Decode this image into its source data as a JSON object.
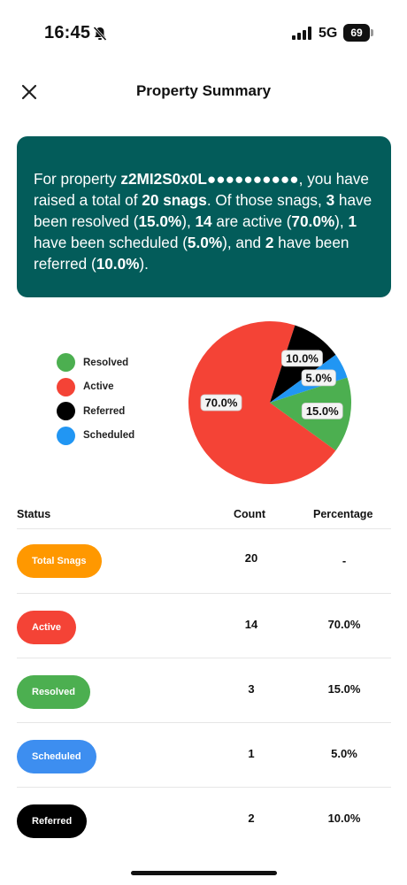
{
  "status_bar": {
    "time": "16:45",
    "network": "5G",
    "battery": "69",
    "bell_icon": "bell-muted-icon",
    "signal_icon": "signal-bars-icon"
  },
  "header": {
    "title": "Property Summary",
    "close_icon": "close-icon"
  },
  "summary": {
    "t1": "For property ",
    "property_id": "z2MI2S0x0L●●●●●●●●●●",
    "t2": ", you have raised a total of ",
    "total": "20 snags",
    "t3": ". Of those snags, ",
    "resolved_count": "3",
    "t4": " have been resolved (",
    "resolved_pct": "15.0%",
    "t5": "), ",
    "active_count": "14",
    "t6": " are active (",
    "active_pct": "70.0%",
    "t7": "), ",
    "scheduled_count": "1",
    "t8": " have been scheduled (",
    "scheduled_pct": "5.0%",
    "t9": "), and ",
    "referred_count": "2",
    "t10": " have been referred (",
    "referred_pct": "10.0%",
    "t11": ")."
  },
  "legend": [
    {
      "label": "Resolved",
      "color": "#4caf50"
    },
    {
      "label": "Active",
      "color": "#f44336"
    },
    {
      "label": "Referred",
      "color": "#000000"
    },
    {
      "label": "Scheduled",
      "color": "#2196f3"
    }
  ],
  "chart_data": {
    "type": "pie",
    "slices": [
      {
        "name": "Resolved",
        "value": 15.0,
        "label": "15.0%",
        "color": "#4caf50"
      },
      {
        "name": "Active",
        "value": 70.0,
        "label": "70.0%",
        "color": "#f44336"
      },
      {
        "name": "Referred",
        "value": 10.0,
        "label": "10.0%",
        "color": "#000000"
      },
      {
        "name": "Scheduled",
        "value": 5.0,
        "label": "5.0%",
        "color": "#2196f3"
      }
    ]
  },
  "table": {
    "headers": {
      "status": "Status",
      "count": "Count",
      "percentage": "Percentage"
    },
    "rows": [
      {
        "status": "Total Snags",
        "count": "20",
        "percentage": "-",
        "color": "#ff9800"
      },
      {
        "status": "Active",
        "count": "14",
        "percentage": "70.0%",
        "color": "#f44336"
      },
      {
        "status": "Resolved",
        "count": "3",
        "percentage": "15.0%",
        "color": "#4caf50"
      },
      {
        "status": "Scheduled",
        "count": "1",
        "percentage": "5.0%",
        "color": "#3d8ef0"
      },
      {
        "status": "Referred",
        "count": "2",
        "percentage": "10.0%",
        "color": "#000000"
      }
    ]
  }
}
